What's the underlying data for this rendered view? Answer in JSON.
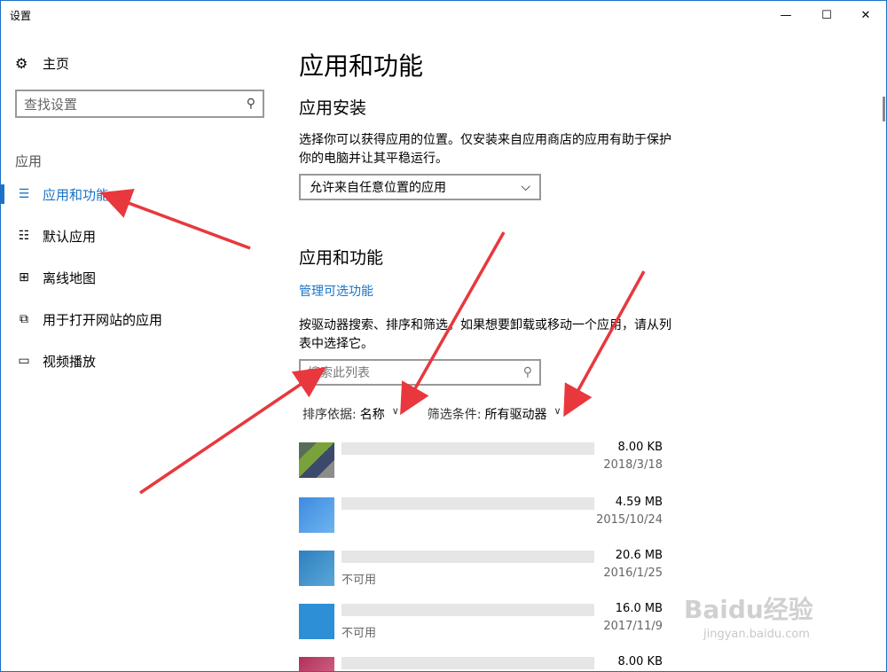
{
  "window": {
    "title": "设置",
    "minimize_glyph": "—",
    "maximize_glyph": "☐",
    "close_glyph": "✕"
  },
  "sidebar": {
    "home_label": "主页",
    "home_icon": "gear-icon",
    "search_placeholder": "查找设置",
    "section_label": "应用",
    "items": [
      {
        "label": "应用和功能",
        "icon": "list-icon",
        "active": true
      },
      {
        "label": "默认应用",
        "icon": "default-apps-icon",
        "active": false
      },
      {
        "label": "离线地图",
        "icon": "map-icon",
        "active": false
      },
      {
        "label": "用于打开网站的应用",
        "icon": "website-icon",
        "active": false
      },
      {
        "label": "视频播放",
        "icon": "video-icon",
        "active": false
      }
    ]
  },
  "main": {
    "page_title": "应用和功能",
    "install_heading": "应用安装",
    "install_desc": "选择你可以获得应用的位置。仅安装来自应用商店的应用有助于保护你的电脑并让其平稳运行。",
    "install_option": "允许来自任意位置的应用",
    "apps_heading": "应用和功能",
    "manage_link": "管理可选功能",
    "apps_desc": "按驱动器搜索、排序和筛选。如果想要卸载或移动一个应用，请从列表中选择它。",
    "apps_search_placeholder": "搜索此列表",
    "sort_label": "排序依据:",
    "sort_value": "名称",
    "filter_label": "筛选条件:",
    "filter_value": "所有驱动器",
    "apps": [
      {
        "size": "8.00 KB",
        "date": "2018/3/18",
        "sub": ""
      },
      {
        "size": "4.59 MB",
        "date": "2015/10/24",
        "sub": ""
      },
      {
        "size": "20.6 MB",
        "date": "2016/1/25",
        "sub": "不可用"
      },
      {
        "size": "16.0 MB",
        "date": "2017/11/9",
        "sub": "不可用"
      },
      {
        "size": "8.00 KB",
        "date": "",
        "sub": ""
      }
    ]
  },
  "colors": {
    "accent": "#1a73c7",
    "arrow": "#e8383d"
  },
  "watermark": {
    "brand": "Baidu经验",
    "url": "jingyan.baidu.com"
  }
}
